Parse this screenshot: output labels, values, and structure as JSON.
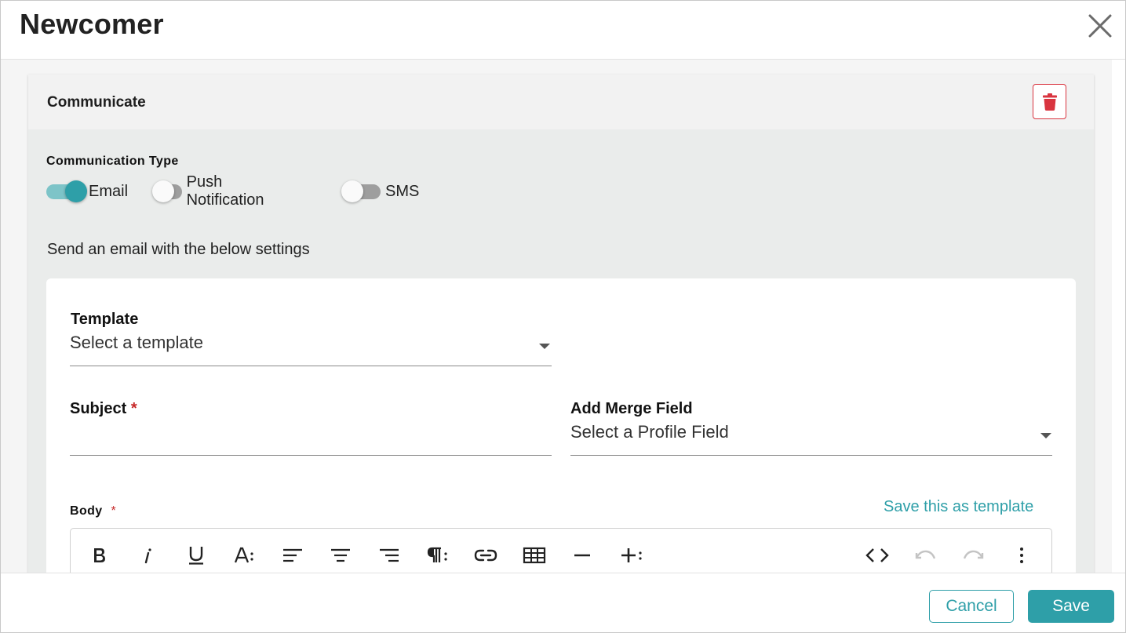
{
  "dialog": {
    "title": "Newcomer",
    "close_icon": "close-icon"
  },
  "card": {
    "title": "Communicate",
    "delete_icon": "trash-icon",
    "delete_color": "#d9343f"
  },
  "communication_type": {
    "label": "Communication Type",
    "options": [
      {
        "label": "Email",
        "on": true
      },
      {
        "label": "Push Notification",
        "on": false
      },
      {
        "label": "SMS",
        "on": false
      }
    ]
  },
  "send_text": "Send an email with the below settings",
  "form": {
    "template": {
      "label": "Template",
      "value": "Select a template"
    },
    "subject": {
      "label": "Subject",
      "required_mark": "*",
      "value": ""
    },
    "merge_field": {
      "label": "Add Merge Field",
      "value": "Select a Profile Field"
    },
    "body": {
      "label": "Body",
      "required_mark": "*"
    },
    "save_as_template": "Save this as template"
  },
  "editor_toolbar": [
    "bold-icon",
    "italic-icon",
    "underline-icon",
    "font-size-icon",
    "align-left-icon",
    "align-center-icon",
    "align-right-icon",
    "paragraph-format-icon",
    "link-icon",
    "table-icon",
    "horizontal-line-icon",
    "insert-more-icon",
    "code-view-icon",
    "undo-icon",
    "redo-icon",
    "more-options-icon"
  ],
  "footer": {
    "cancel_label": "Cancel",
    "save_label": "Save"
  },
  "colors": {
    "accent": "#2e9fa8",
    "danger": "#d9343f",
    "required": "#c62828"
  }
}
